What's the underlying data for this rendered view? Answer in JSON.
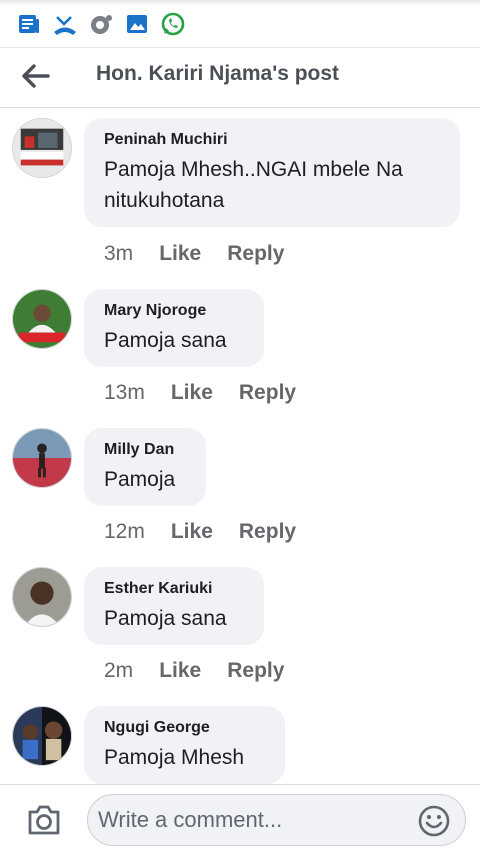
{
  "status_bar": {
    "icons": [
      "news-icon",
      "missed-call-icon",
      "sync-icon",
      "gallery-icon",
      "whatsapp-icon"
    ],
    "icon_color": "#1a73c9",
    "whatsapp_color": "#25a244"
  },
  "header": {
    "back_icon": "arrow-left-icon",
    "title": "Hon. Kariri Njama's post"
  },
  "comments": [
    {
      "author": "Peninah Muchiri",
      "text": "Pamoja Mhesh..NGAI mbele Na nitukuhotana",
      "time": "3m",
      "like": "Like",
      "reply": "Reply"
    },
    {
      "author": "Mary Njoroge",
      "text": "Pamoja sana",
      "time": "13m",
      "like": "Like",
      "reply": "Reply"
    },
    {
      "author": "Milly Dan",
      "text": "Pamoja",
      "time": "12m",
      "like": "Like",
      "reply": "Reply"
    },
    {
      "author": "Esther Kariuki",
      "text": "Pamoja sana",
      "time": "2m",
      "like": "Like",
      "reply": "Reply"
    },
    {
      "author": "Ngugi George",
      "text": "Pamoja Mhesh"
    }
  ],
  "composer": {
    "camera_icon": "camera-icon",
    "placeholder": "Write a comment...",
    "emoji_icon": "emoji-smile-icon"
  },
  "colors": {
    "bubble_bg": "#f0f2f5",
    "meta_text": "#65676b",
    "title_text": "#4b4f56"
  }
}
